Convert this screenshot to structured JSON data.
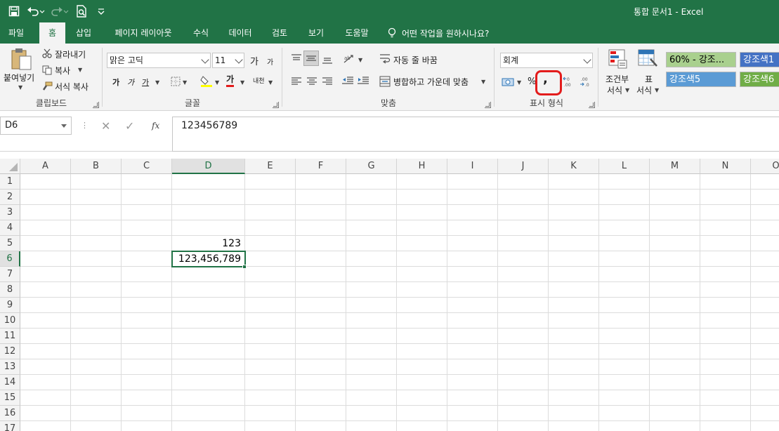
{
  "window": {
    "title": "통합 문서1  -  Excel"
  },
  "qat": {
    "icons": [
      "save-icon",
      "undo-icon",
      "redo-icon",
      "print-preview-icon",
      "customize-icon"
    ]
  },
  "tabs": [
    "파일",
    "홈",
    "삽입",
    "페이지 레이아웃",
    "수식",
    "데이터",
    "검토",
    "보기",
    "도움말"
  ],
  "active_tab": "홈",
  "tell_me": "어떤 작업을 원하시나요?",
  "ribbon": {
    "clipboard": {
      "label": "클립보드",
      "paste": "붙여넣기",
      "cut": "잘라내기",
      "copy": "복사",
      "format_painter": "서식 복사"
    },
    "font": {
      "label": "글꼴",
      "font_name": "맑은 고딕",
      "font_size": "11",
      "grow": "가",
      "shrink": "가",
      "bold": "가",
      "italic": "가",
      "underline": "가",
      "font_color_letter": "가",
      "phonetic": "내천"
    },
    "alignment": {
      "label": "맞춤",
      "wrap_text": "자동 줄 바꿈",
      "merge_center": "병합하고 가운데 맞춤"
    },
    "number": {
      "label": "표시 형식",
      "format": "회계",
      "percent": "%",
      "comma": ",",
      "inc_decimal": ".00",
      "dec_decimal": ".00"
    },
    "styles": {
      "cond_format_1": "조건부",
      "cond_format_2": "서식",
      "table_format_1": "표",
      "table_format_2": "서식",
      "tiles": [
        "60% - 강조...",
        "강조색1",
        "강조색5",
        "강조색6"
      ]
    }
  },
  "colors": {
    "brand": "#217346",
    "highlight": "#e31c1c",
    "tile_1": "#a9d08e",
    "tile_2": "#4472c4",
    "tile_3": "#5b9bd5",
    "tile_4": "#70ad47"
  },
  "formula_bar": {
    "name_box": "D6",
    "cancel": "✕",
    "enter": "✓",
    "fx": "fx",
    "formula": "123456789"
  },
  "grid": {
    "columns": [
      "A",
      "B",
      "C",
      "D",
      "E",
      "F",
      "G",
      "H",
      "I",
      "J",
      "K",
      "L",
      "M",
      "N",
      "O"
    ],
    "rows": [
      "1",
      "2",
      "3",
      "4",
      "5",
      "6",
      "7",
      "8",
      "9",
      "10",
      "11",
      "12",
      "13",
      "14",
      "15",
      "16",
      "17"
    ],
    "selected_column": "D",
    "selected_row": "6",
    "cells": {
      "D5": "123",
      "D6": "123,456,789"
    }
  }
}
